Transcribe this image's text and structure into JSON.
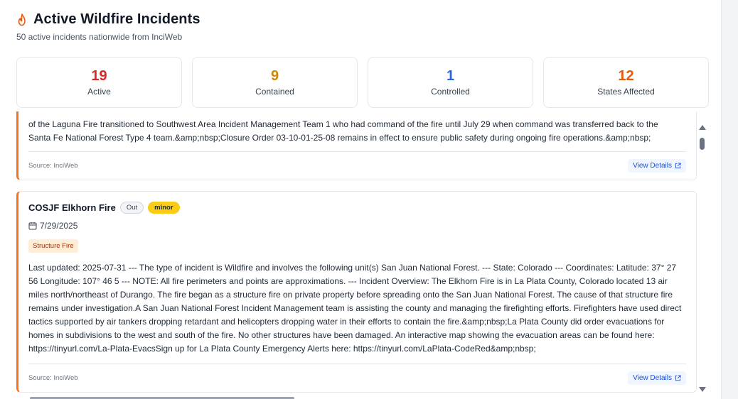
{
  "header": {
    "title": "Active Wildfire Incidents",
    "subtitle": "50 active incidents nationwide from InciWeb",
    "icon": "flame-icon",
    "accent": "#ea580c"
  },
  "stats": [
    {
      "value": "19",
      "label": "Active",
      "color": "#dc2626"
    },
    {
      "value": "9",
      "label": "Contained",
      "color": "#ca8a04"
    },
    {
      "value": "1",
      "label": "Controlled",
      "color": "#2563eb"
    },
    {
      "value": "12",
      "label": "States Affected",
      "color": "#ea580c"
    }
  ],
  "incidents": [
    {
      "description": "of the Laguna Fire transitioned to Southwest Area Incident Management Team 1 who had command of the fire until July 29 when command was transferred back to the Santa Fe National Forest Type 4 team.&amp;nbsp;Closure Order 03-10-01-25-08 remains in effect to ensure public safety during ongoing fire operations.&amp;nbsp;",
      "source": "Source: InciWeb",
      "view_label": "View Details"
    },
    {
      "name": "COSJF Elkhorn Fire",
      "status": "Out",
      "severity": "minor",
      "date": "7/29/2025",
      "tag": "Structure Fire",
      "description": "Last updated: 2025-07-31 --- The type of incident is Wildfire and involves the following unit(s) San Juan National Forest. --- State: Colorado --- Coordinates: Latitude: 37° 27 56 Longitude: 107° 46 5 --- NOTE: All fire perimeters and points are approximations. --- Incident Overview: The Elkhorn Fire is in La Plata County, Colorado located 13 air miles north/northeast of Durango. The fire began as a structure fire on private property before spreading onto the San Juan National Forest. The cause of that structure fire remains under investigation.A San Juan National Forest Incident Management team is assisting the county and managing the firefighting efforts. Firefighters have used direct tactics supported by air tankers dropping retardant and helicopters dropping water in their efforts to contain the fire.&amp;nbsp;La Plata County did order evacuations for homes in subdivisions to the west and south of the fire. No other structures have been damaged. An interactive map showing the evacuation areas can be found here: https://tinyurl.com/La-Plata-EvacsSign up for La Plata County Emergency Alerts here: https://tinyurl.com/LaPlata-CodeRed&amp;nbsp;",
      "source": "Source: InciWeb",
      "view_label": "View Details"
    }
  ]
}
